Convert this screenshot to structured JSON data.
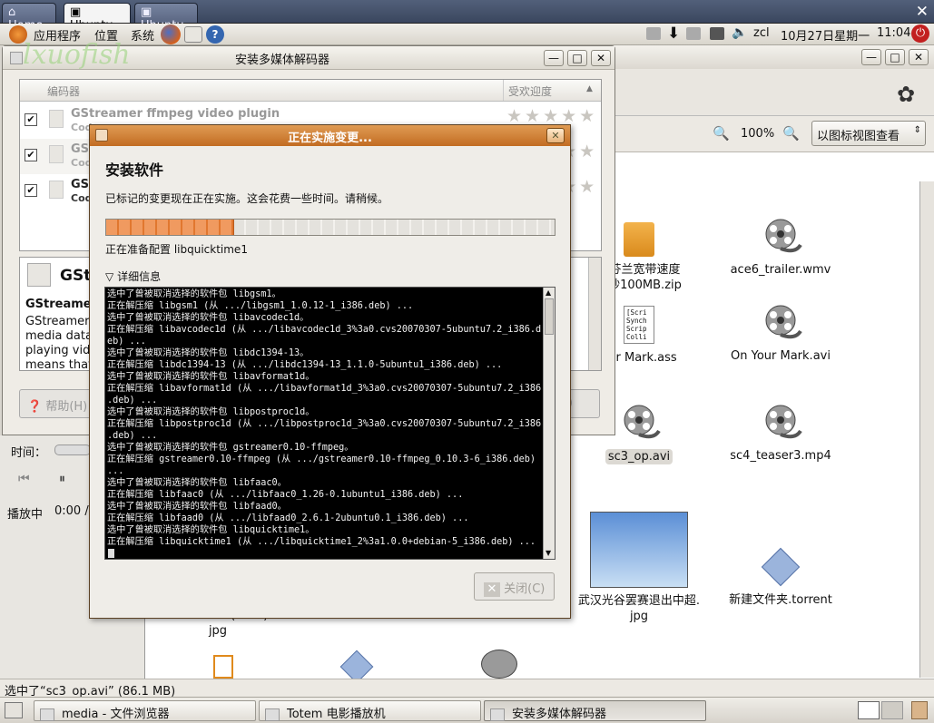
{
  "vnc": {
    "tabs": [
      {
        "label": "Home"
      },
      {
        "label": "Ubuntu"
      },
      {
        "label": "Ubuntu"
      }
    ],
    "close": "✕"
  },
  "panel": {
    "menus": [
      "应用程序",
      "位置",
      "系统"
    ],
    "user": "zcl",
    "date": "10月27日星期一",
    "time": "11:04"
  },
  "codec_window": {
    "title": "安装多媒体解码器",
    "col_codec": "编码器",
    "col_pop": "受欢迎度",
    "rows": [
      {
        "name": "GStreamer ffmpeg video plugin",
        "sub": "Cod",
        "checked": true
      },
      {
        "name": "GSt",
        "sub": "Cod",
        "checked": true
      },
      {
        "name": "GSt",
        "sub": "Cod",
        "checked": true
      }
    ],
    "detail_head": "GStr",
    "detail_title": "GStreame",
    "detail_lines": [
      "GStreamer",
      "media data",
      "playing vide",
      "means that"
    ],
    "help_button": "帮助(H)",
    "right_button_partial": "J)"
  },
  "file_manager": {
    "zoom": "100%",
    "view_select": "以图标视图查看",
    "files": [
      {
        "name": "年芬兰宽带速度\n每秒100MB.zip",
        "icon": "archive"
      },
      {
        "name": "ace6_trailer.wmv",
        "icon": "film"
      },
      {
        "name": "our Mark.ass",
        "icon": "script"
      },
      {
        "name": "On Your Mark.avi",
        "icon": "film"
      },
      {
        "name": "sc3_op.avi",
        "icon": "film",
        "selected": true
      },
      {
        "name": "sc4_teaser3.mp4",
        "icon": "film"
      },
      {
        "name": "武汉光谷罢赛退出中超.\njpg",
        "icon": "image"
      },
      {
        "name": "新建文件夹.torrent",
        "icon": "torrent"
      },
      {
        "name": "of sadness (front).\njpg",
        "icon": "none"
      }
    ],
    "script_icon_lines": [
      "[Scri",
      "Synch",
      "Scrip",
      "Colli"
    ]
  },
  "totem": {
    "time_label": "时间：",
    "status": "播放中",
    "time": "0:00 /"
  },
  "dialog": {
    "title": "正在实施变更...",
    "heading": "安装软件",
    "description": "已标记的变更现在正在实施。这会花费一些时间。请稍候。",
    "progress": 0.285,
    "status": "正在准备配置 libquicktime1",
    "details_label": "详细信息",
    "close_button": "关闭(C)",
    "terminal": "选中了曾被取消选择的软件包 libgsm1。\n正在解压缩 libgsm1 (从 .../libgsm1_1.0.12-1_i386.deb) ...\n选中了曾被取消选择的软件包 libavcodec1d。\n正在解压缩 libavcodec1d (从 .../libavcodec1d_3%3a0.cvs20070307-5ubuntu7.2_i386.d\neb) ...\n选中了曾被取消选择的软件包 libdc1394-13。\n正在解压缩 libdc1394-13 (从 .../libdc1394-13_1.1.0-5ubuntu1_i386.deb) ...\n选中了曾被取消选择的软件包 libavformat1d。\n正在解压缩 libavformat1d (从 .../libavformat1d_3%3a0.cvs20070307-5ubuntu7.2_i386\n.deb) ...\n选中了曾被取消选择的软件包 libpostproc1d。\n正在解压缩 libpostproc1d (从 .../libpostproc1d_3%3a0.cvs20070307-5ubuntu7.2_i386\n.deb) ...\n选中了曾被取消选择的软件包 gstreamer0.10-ffmpeg。\n正在解压缩 gstreamer0.10-ffmpeg (从 .../gstreamer0.10-ffmpeg_0.10.3-6_i386.deb)\n...\n选中了曾被取消选择的软件包 libfaac0。\n正在解压缩 libfaac0 (从 .../libfaac0_1.26-0.1ubuntu1_i386.deb) ...\n选中了曾被取消选择的软件包 libfaad0。\n正在解压缩 libfaad0 (从 .../libfaad0_2.6.1-2ubuntu0.1_i386.deb) ...\n选中了曾被取消选择的软件包 libquicktime1。\n正在解压缩 libquicktime1 (从 .../libquicktime1_2%3a1.0.0+debian-5_i386.deb) ..."
  },
  "statusbar": "选中了“sc3_op.avi” (86.1 MB)",
  "taskbar": [
    "media - 文件浏览器",
    "Totem 电影播放机",
    "安装多媒体解码器"
  ],
  "colors": {
    "accent": "#e1772f",
    "titlebar": "#c26c22",
    "terminal_bg": "#000000"
  }
}
